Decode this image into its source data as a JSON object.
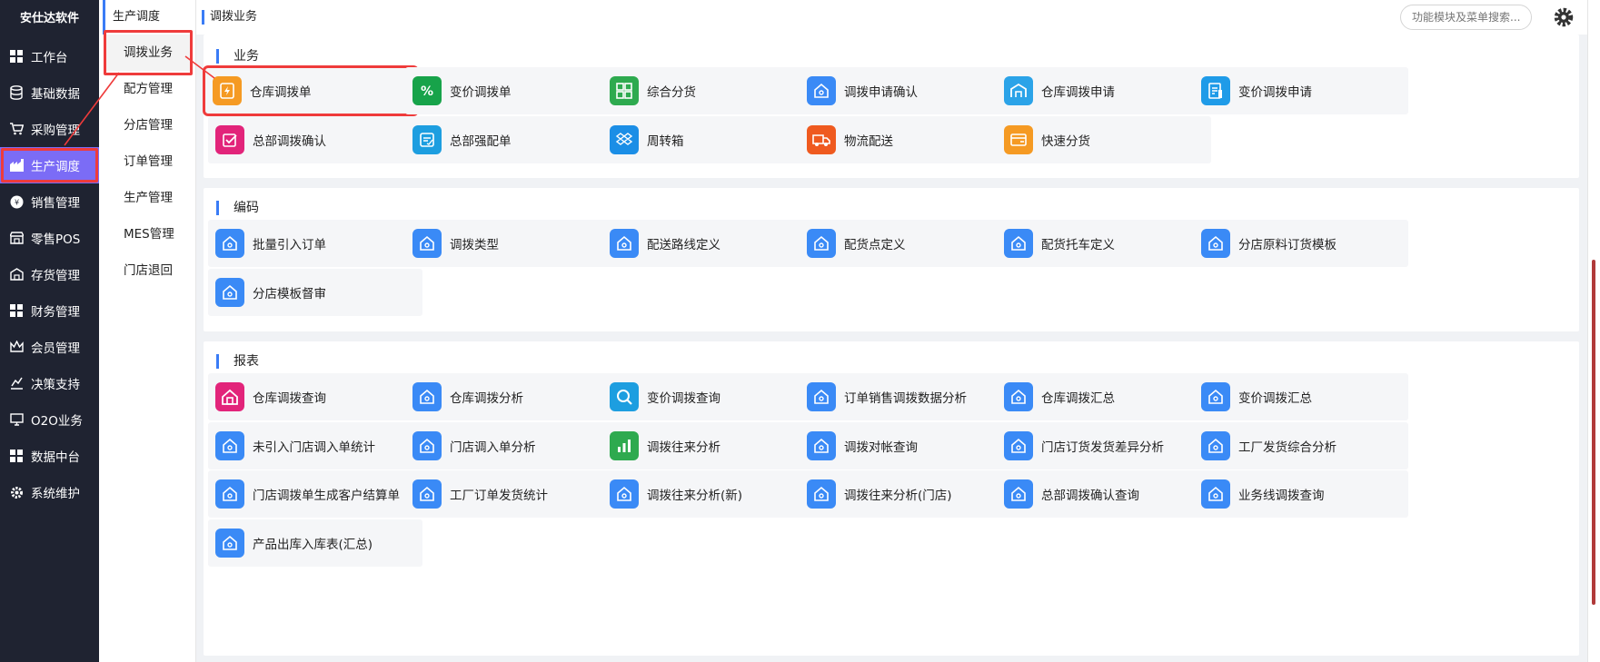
{
  "brand": "安仕达软件",
  "sidebar": {
    "items": [
      {
        "label": "工作台",
        "icon": "grid-icon"
      },
      {
        "label": "基础数据",
        "icon": "database-icon"
      },
      {
        "label": "采购管理",
        "icon": "cart-icon"
      },
      {
        "label": "生产调度",
        "icon": "factory-icon"
      },
      {
        "label": "销售管理",
        "icon": "sales-icon"
      },
      {
        "label": "零售POS",
        "icon": "store-icon"
      },
      {
        "label": "存货管理",
        "icon": "warehouse-icon"
      },
      {
        "label": "财务管理",
        "icon": "grid-icon"
      },
      {
        "label": "会员管理",
        "icon": "crown-icon"
      },
      {
        "label": "决策支持",
        "icon": "chart-icon"
      },
      {
        "label": "O2O业务",
        "icon": "monitor-icon"
      },
      {
        "label": "数据中台",
        "icon": "grid-icon"
      },
      {
        "label": "系统维护",
        "icon": "gear-icon"
      }
    ],
    "active_index": 3
  },
  "submenu": {
    "title": "生产调度",
    "items": [
      "调拨业务",
      "配方管理",
      "分店管理",
      "订单管理",
      "生产管理",
      "MES管理",
      "门店退回"
    ]
  },
  "topbar": {
    "breadcrumb": "调拨业务",
    "search_placeholder": "功能模块及菜单搜索..."
  },
  "sections": {
    "business": {
      "title": "业务",
      "tiles": [
        "仓库调拨单",
        "变价调拨单",
        "综合分货",
        "调拨申请确认",
        "仓库调拨申请",
        "变价调拨申请",
        "总部调拨确认",
        "总部强配单",
        "周转箱",
        "物流配送",
        "快速分货"
      ]
    },
    "coding": {
      "title": "编码",
      "tiles": [
        "批量引入订单",
        "调拨类型",
        "配送路线定义",
        "配货点定义",
        "配货托车定义",
        "分店原料订货模板",
        "分店模板督审"
      ]
    },
    "reports": {
      "title": "报表",
      "tiles": [
        "仓库调拨查询",
        "仓库调拨分析",
        "变价调拨查询",
        "订单销售调拨数据分析",
        "仓库调拨汇总",
        "变价调拨汇总",
        "未引入门店调入单统计",
        "门店调入单分析",
        "调拨往来分析",
        "调拨对帐查询",
        "门店订货发货差异分析",
        "工厂发货综合分析",
        "门店调拨单生成客户结算单",
        "工厂订单发货统计",
        "调拨往来分析(新)",
        "调拨往来分析(门店)",
        "总部调拨确认查询",
        "业务线调拨查询",
        "产品出库入库表(汇总)"
      ]
    }
  },
  "colors": {
    "accent": "#3a7cf6",
    "sidebar_bg": "#1f2331",
    "active_nav": "#7b6cf6",
    "highlight": "#ef3b3b"
  }
}
